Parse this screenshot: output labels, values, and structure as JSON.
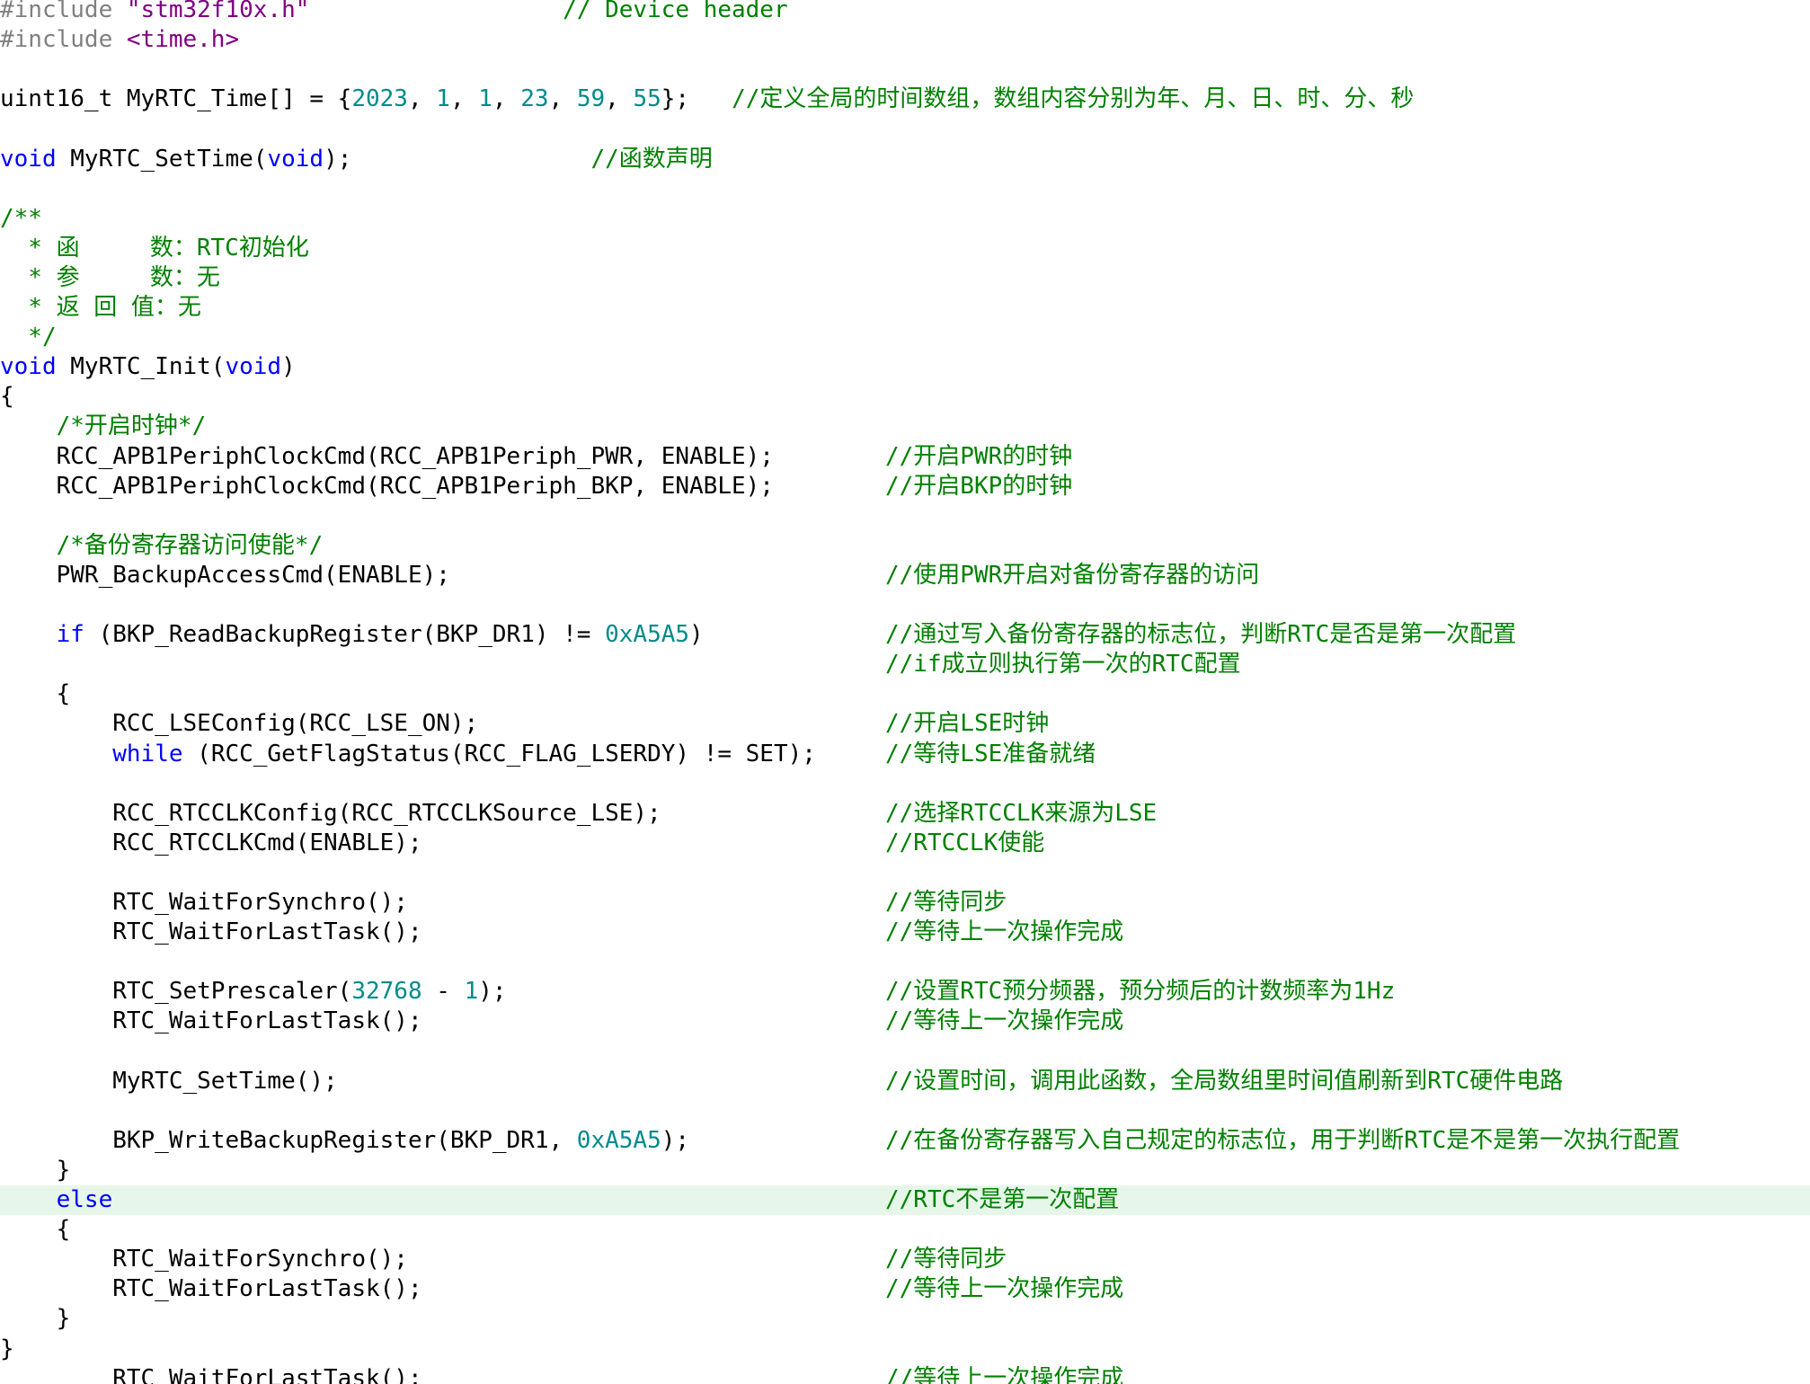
{
  "editor": {
    "lines": [
      {
        "tokens": [
          {
            "t": "#include ",
            "c": "pp"
          },
          {
            "t": "\"stm32f10x.h\"",
            "c": "str"
          },
          {
            "t": "                  ",
            "c": "plain"
          },
          {
            "t": "// Device header",
            "c": "cmt"
          }
        ]
      },
      {
        "tokens": [
          {
            "t": "#include ",
            "c": "pp"
          },
          {
            "t": "<time.h>",
            "c": "str"
          }
        ]
      },
      {
        "tokens": []
      },
      {
        "tokens": [
          {
            "t": "uint16_t MyRTC_Time[] = {",
            "c": "plain"
          },
          {
            "t": "2023",
            "c": "num"
          },
          {
            "t": ", ",
            "c": "plain"
          },
          {
            "t": "1",
            "c": "num"
          },
          {
            "t": ", ",
            "c": "plain"
          },
          {
            "t": "1",
            "c": "num"
          },
          {
            "t": ", ",
            "c": "plain"
          },
          {
            "t": "23",
            "c": "num"
          },
          {
            "t": ", ",
            "c": "plain"
          },
          {
            "t": "59",
            "c": "num"
          },
          {
            "t": ", ",
            "c": "plain"
          },
          {
            "t": "55",
            "c": "num"
          },
          {
            "t": "};   ",
            "c": "plain"
          },
          {
            "t": "//定义全局的时间数组，数组内容分别为年、月、日、时、分、秒",
            "c": "cmt"
          }
        ]
      },
      {
        "tokens": []
      },
      {
        "tokens": [
          {
            "t": "void",
            "c": "kw"
          },
          {
            "t": " MyRTC_SetTime(",
            "c": "plain"
          },
          {
            "t": "void",
            "c": "kw"
          },
          {
            "t": ");                 ",
            "c": "plain"
          },
          {
            "t": "//函数声明",
            "c": "cmt"
          }
        ]
      },
      {
        "tokens": []
      },
      {
        "tokens": [
          {
            "t": "/**",
            "c": "cmt"
          }
        ]
      },
      {
        "tokens": [
          {
            "t": "  * 函     数：RTC初始化",
            "c": "cmt"
          }
        ]
      },
      {
        "tokens": [
          {
            "t": "  * 参     数：无",
            "c": "cmt"
          }
        ]
      },
      {
        "tokens": [
          {
            "t": "  * 返 回 值：无",
            "c": "cmt"
          }
        ]
      },
      {
        "tokens": [
          {
            "t": "  */",
            "c": "cmt"
          }
        ]
      },
      {
        "tokens": [
          {
            "t": "void",
            "c": "kw"
          },
          {
            "t": " MyRTC_Init(",
            "c": "plain"
          },
          {
            "t": "void",
            "c": "kw"
          },
          {
            "t": ")",
            "c": "plain"
          }
        ]
      },
      {
        "tokens": [
          {
            "t": "{",
            "c": "plain"
          }
        ]
      },
      {
        "tokens": [
          {
            "t": "    /*开启时钟*/",
            "c": "cmt"
          }
        ]
      },
      {
        "tokens": [
          {
            "t": "    RCC_APB1PeriphClockCmd(RCC_APB1Periph_PWR, ENABLE);",
            "c": "plain"
          }
        ],
        "comment": "//开启PWR的时钟"
      },
      {
        "tokens": [
          {
            "t": "    RCC_APB1PeriphClockCmd(RCC_APB1Periph_BKP, ENABLE);",
            "c": "plain"
          }
        ],
        "comment": "//开启BKP的时钟"
      },
      {
        "tokens": []
      },
      {
        "tokens": [
          {
            "t": "    /*备份寄存器访问使能*/",
            "c": "cmt"
          }
        ]
      },
      {
        "tokens": [
          {
            "t": "    PWR_BackupAccessCmd(ENABLE);",
            "c": "plain"
          }
        ],
        "comment": "//使用PWR开启对备份寄存器的访问"
      },
      {
        "tokens": []
      },
      {
        "tokens": [
          {
            "t": "    ",
            "c": "plain"
          },
          {
            "t": "if",
            "c": "kw"
          },
          {
            "t": " (BKP_ReadBackupRegister(BKP_DR1) != ",
            "c": "plain"
          },
          {
            "t": "0xA5A5",
            "c": "num"
          },
          {
            "t": ")",
            "c": "plain"
          }
        ],
        "comment": "//通过写入备份寄存器的标志位，判断RTC是否是第一次配置"
      },
      {
        "tokens": [],
        "comment": "//if成立则执行第一次的RTC配置"
      },
      {
        "tokens": [
          {
            "t": "    {",
            "c": "plain"
          }
        ]
      },
      {
        "tokens": [
          {
            "t": "        RCC_LSEConfig(RCC_LSE_ON);",
            "c": "plain"
          }
        ],
        "comment": "//开启LSE时钟"
      },
      {
        "tokens": [
          {
            "t": "        ",
            "c": "plain"
          },
          {
            "t": "while",
            "c": "kw"
          },
          {
            "t": " (RCC_GetFlagStatus(RCC_FLAG_LSERDY) != SET);",
            "c": "plain"
          }
        ],
        "comment": "//等待LSE准备就绪"
      },
      {
        "tokens": []
      },
      {
        "tokens": [
          {
            "t": "        RCC_RTCCLKConfig(RCC_RTCCLKSource_LSE);",
            "c": "plain"
          }
        ],
        "comment": "//选择RTCCLK来源为LSE"
      },
      {
        "tokens": [
          {
            "t": "        RCC_RTCCLKCmd(ENABLE);",
            "c": "plain"
          }
        ],
        "comment": "//RTCCLK使能"
      },
      {
        "tokens": []
      },
      {
        "tokens": [
          {
            "t": "        RTC_WaitForSynchro();",
            "c": "plain"
          }
        ],
        "comment": "//等待同步"
      },
      {
        "tokens": [
          {
            "t": "        RTC_WaitForLastTask();",
            "c": "plain"
          }
        ],
        "comment": "//等待上一次操作完成"
      },
      {
        "tokens": []
      },
      {
        "tokens": [
          {
            "t": "        RTC_SetPrescaler(",
            "c": "plain"
          },
          {
            "t": "32768",
            "c": "num"
          },
          {
            "t": " - ",
            "c": "plain"
          },
          {
            "t": "1",
            "c": "num"
          },
          {
            "t": ");",
            "c": "plain"
          }
        ],
        "comment": "//设置RTC预分频器，预分频后的计数频率为1Hz"
      },
      {
        "tokens": [
          {
            "t": "        RTC_WaitForLastTask();",
            "c": "plain"
          }
        ],
        "comment": "//等待上一次操作完成"
      },
      {
        "tokens": []
      },
      {
        "tokens": [
          {
            "t": "        MyRTC_SetTime();",
            "c": "plain"
          }
        ],
        "comment": "//设置时间，调用此函数，全局数组里时间值刷新到RTC硬件电路"
      },
      {
        "tokens": []
      },
      {
        "tokens": [
          {
            "t": "        BKP_WriteBackupRegister(BKP_DR1, ",
            "c": "plain"
          },
          {
            "t": "0xA5A5",
            "c": "num"
          },
          {
            "t": ");",
            "c": "plain"
          }
        ],
        "comment": "//在备份寄存器写入自己规定的标志位，用于判断RTC是不是第一次执行配置"
      },
      {
        "tokens": [
          {
            "t": "    }",
            "c": "plain"
          }
        ]
      },
      {
        "tokens": [
          {
            "t": "    ",
            "c": "plain"
          },
          {
            "t": "else",
            "c": "kw"
          }
        ],
        "comment": "//RTC不是第一次配置",
        "current": true
      },
      {
        "tokens": [
          {
            "t": "    {",
            "c": "plain"
          }
        ]
      },
      {
        "tokens": [
          {
            "t": "        RTC_WaitForSynchro();",
            "c": "plain"
          }
        ],
        "comment": "//等待同步"
      },
      {
        "tokens": [
          {
            "t": "        RTC_WaitForLastTask();",
            "c": "plain"
          }
        ],
        "comment": "//等待上一次操作完成"
      },
      {
        "tokens": [
          {
            "t": "    }",
            "c": "plain"
          }
        ]
      },
      {
        "tokens": [
          {
            "t": "}",
            "c": "plain"
          }
        ]
      },
      {
        "tokens": [
          {
            "t": "        RTC_WaitForLastTask();",
            "c": "plain"
          }
        ],
        "comment": "//等待上一次操作完成"
      }
    ]
  },
  "colors": {
    "keyword": "#0000ff",
    "number": "#008b8b",
    "string": "#800080",
    "preprocessor": "#808080",
    "comment": "#008000",
    "plain": "#000000",
    "current_line": "#e6f7e9"
  }
}
